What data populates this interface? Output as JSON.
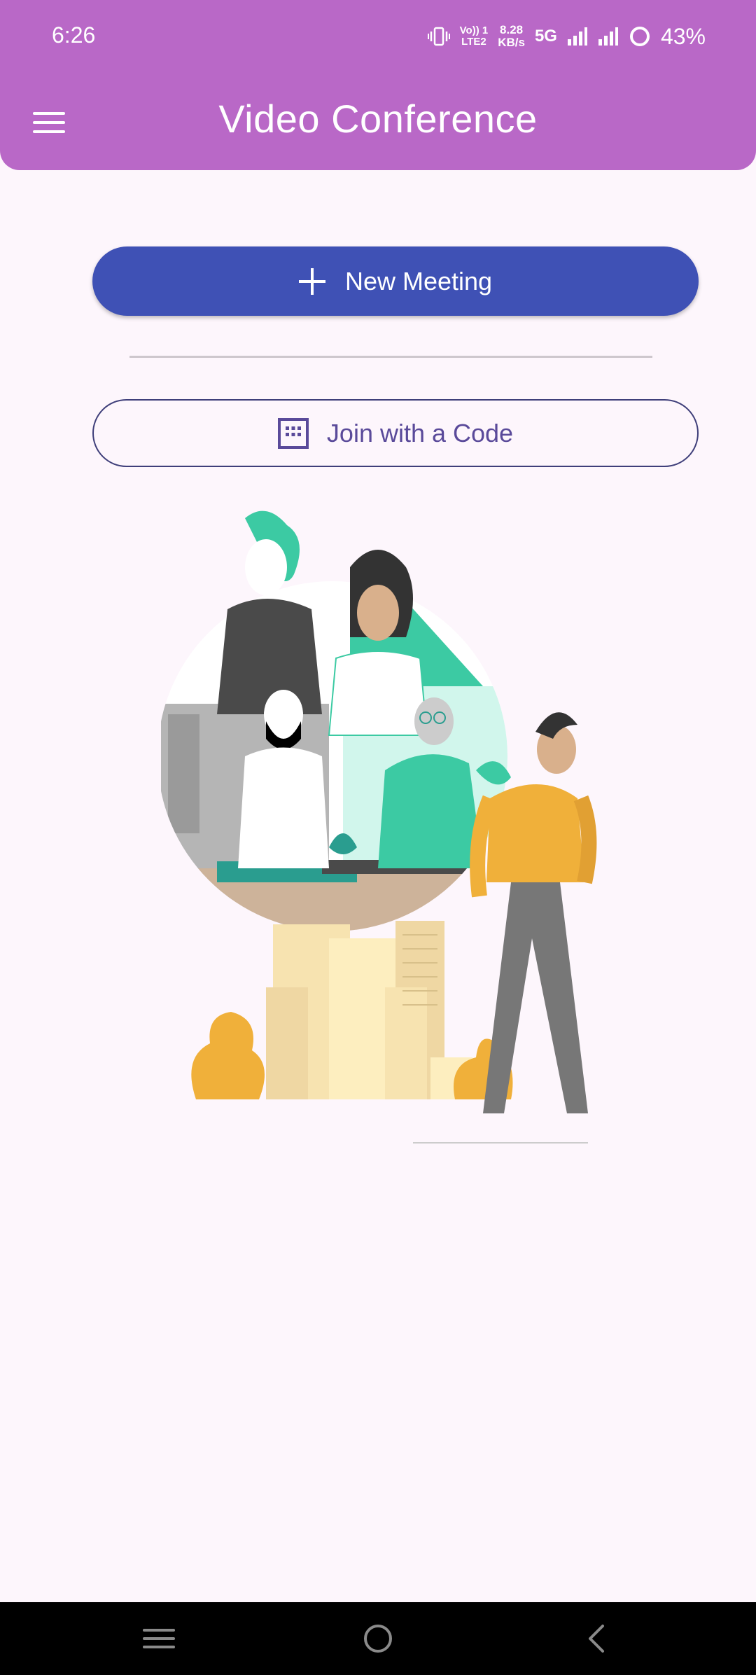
{
  "status_bar": {
    "time": "6:26",
    "volte_line1": "Vo)) 1",
    "volte_line2": "LTE2",
    "speed_line1": "8.28",
    "speed_line2": "KB/s",
    "network": "5G",
    "battery": "43%"
  },
  "app_bar": {
    "title": "Video Conference",
    "menu_icon": "menu-icon",
    "color": "#b968c7"
  },
  "actions": {
    "new_meeting_label": "New Meeting",
    "new_meeting_icon": "plus-icon",
    "join_label": "Join with a Code",
    "join_icon": "keypad-icon",
    "primary_color": "#3f51b5"
  },
  "illustration": {
    "icon": "video-conference-illustration"
  },
  "nav_bar": {
    "recents_icon": "recents-icon",
    "home_icon": "home-icon",
    "back_icon": "back-icon"
  }
}
